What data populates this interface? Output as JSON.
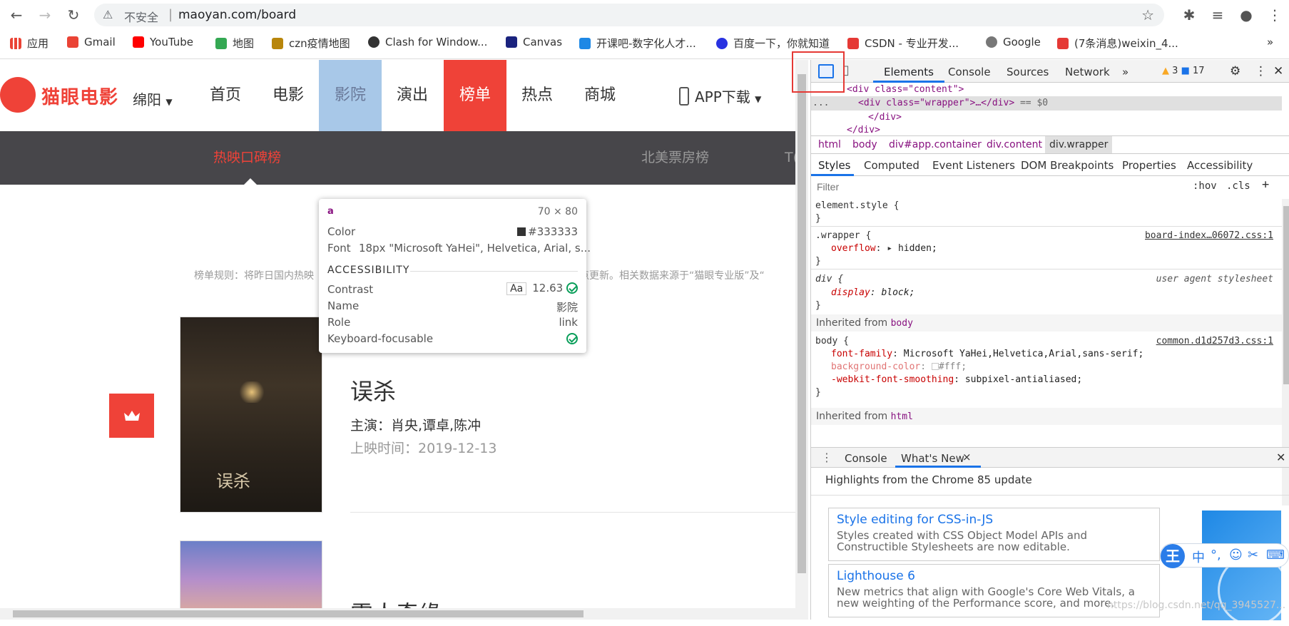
{
  "browser": {
    "insecure_label": "不安全",
    "separator": "|",
    "url": "maoyan.com/board",
    "bookmarks": [
      "应用",
      "Gmail",
      "YouTube",
      "地图",
      "czn疫情地图",
      "Clash for Window...",
      "Canvas",
      "开课吧-数字化人才...",
      "百度一下，你就知道",
      "CSDN - 专业开发...",
      "Google",
      "(7条消息)weixin_4..."
    ],
    "bookmarks_more": "»"
  },
  "page": {
    "logo_text": "猫眼电影",
    "city": "绵阳",
    "nav": [
      "首页",
      "电影",
      "影院",
      "演出",
      "榜单",
      "热点",
      "商城"
    ],
    "app_download": "APP下载",
    "subnav": [
      "热映口碑榜",
      "北美票房榜",
      "T("
    ],
    "rule_left": "榜单规则：将昨日国内热映",
    "rule_right": "点更新。相关数据来源于“猫眼专业版”及“",
    "movie1": {
      "title": "误杀",
      "stars": "主演：肖央,谭卓,陈冲",
      "release": "上映时间：2019-12-13",
      "poster_title": "误杀"
    },
    "movie2": {
      "title": "雪人奇缘"
    }
  },
  "tooltip": {
    "tag": "a",
    "size": "70 × 80",
    "color_label": "Color",
    "color_value": "#333333",
    "font_label": "Font",
    "font_value": "18px \"Microsoft YaHei\", Helvetica, Arial, s...",
    "accessibility_header": "ACCESSIBILITY",
    "contrast_label": "Contrast",
    "contrast_aa": "Aa",
    "contrast_value": "12.63",
    "name_label": "Name",
    "name_value": "影院",
    "role_label": "Role",
    "role_value": "link",
    "keyboard_label": "Keyboard-focusable"
  },
  "devtools": {
    "tabs": [
      "Elements",
      "Console",
      "Sources",
      "Network",
      "»"
    ],
    "warnings": "3",
    "messages": "17",
    "dom": {
      "line1": "<div class=\"content\">",
      "line2_prefix": "<div class=\"wrapper\">…</div>",
      "line2_suffix": "== $0",
      "line3": "</div>",
      "line4": "</div>",
      "dots": "..."
    },
    "breadcrumbs": [
      "html",
      "body",
      "div#app.container",
      "div.content",
      "div.wrapper"
    ],
    "style_tabs": [
      "Styles",
      "Computed",
      "Event Listeners",
      "DOM Breakpoints",
      "Properties",
      "Accessibility"
    ],
    "filter_placeholder": "Filter",
    "hov": ":hov",
    "cls": ".cls",
    "plus": "+",
    "rules": {
      "element_style": "element.style {",
      "close": "}",
      "wrapper_selector": ".wrapper {",
      "wrapper_source": "board-index…06072.css:1",
      "wrapper_prop": "overflow",
      "wrapper_val": "hidden;",
      "div_selector": "div {",
      "div_source": "user agent stylesheet",
      "div_prop": "display",
      "div_val": "block;",
      "inherited_body_label": "Inherited from",
      "inherited_body_tag": "body",
      "body_selector": "body {",
      "body_source": "common.d1d257d3.css:1",
      "body_prop1": "font-family",
      "body_val1": "Microsoft YaHei,Helvetica,Arial,sans-serif;",
      "body_prop2": "background-color",
      "body_val2": "#fff;",
      "body_prop3": "-webkit-font-smoothing",
      "body_val3": "subpixel-antialiased;",
      "inherited_html_label": "Inherited from",
      "inherited_html_tag": "html"
    },
    "drawer": {
      "tabs": [
        "Console",
        "What's New"
      ],
      "close_tab": "×",
      "highlights": "Highlights from the Chrome 85 update",
      "card1_title": "Style editing for CSS-in-JS",
      "card1_desc": "Styles created with CSS Object Model APIs and Constructible Stylesheets are now editable.",
      "card2_title": "Lighthouse 6",
      "card2_desc": "New metrics that align with Google's Core Web Vitals, a new weighting of the Performance score, and more."
    }
  },
  "ime": {
    "logo": "王",
    "mode": "中"
  },
  "watermark": "https://blog.csdn.net/qq_3945527..."
}
